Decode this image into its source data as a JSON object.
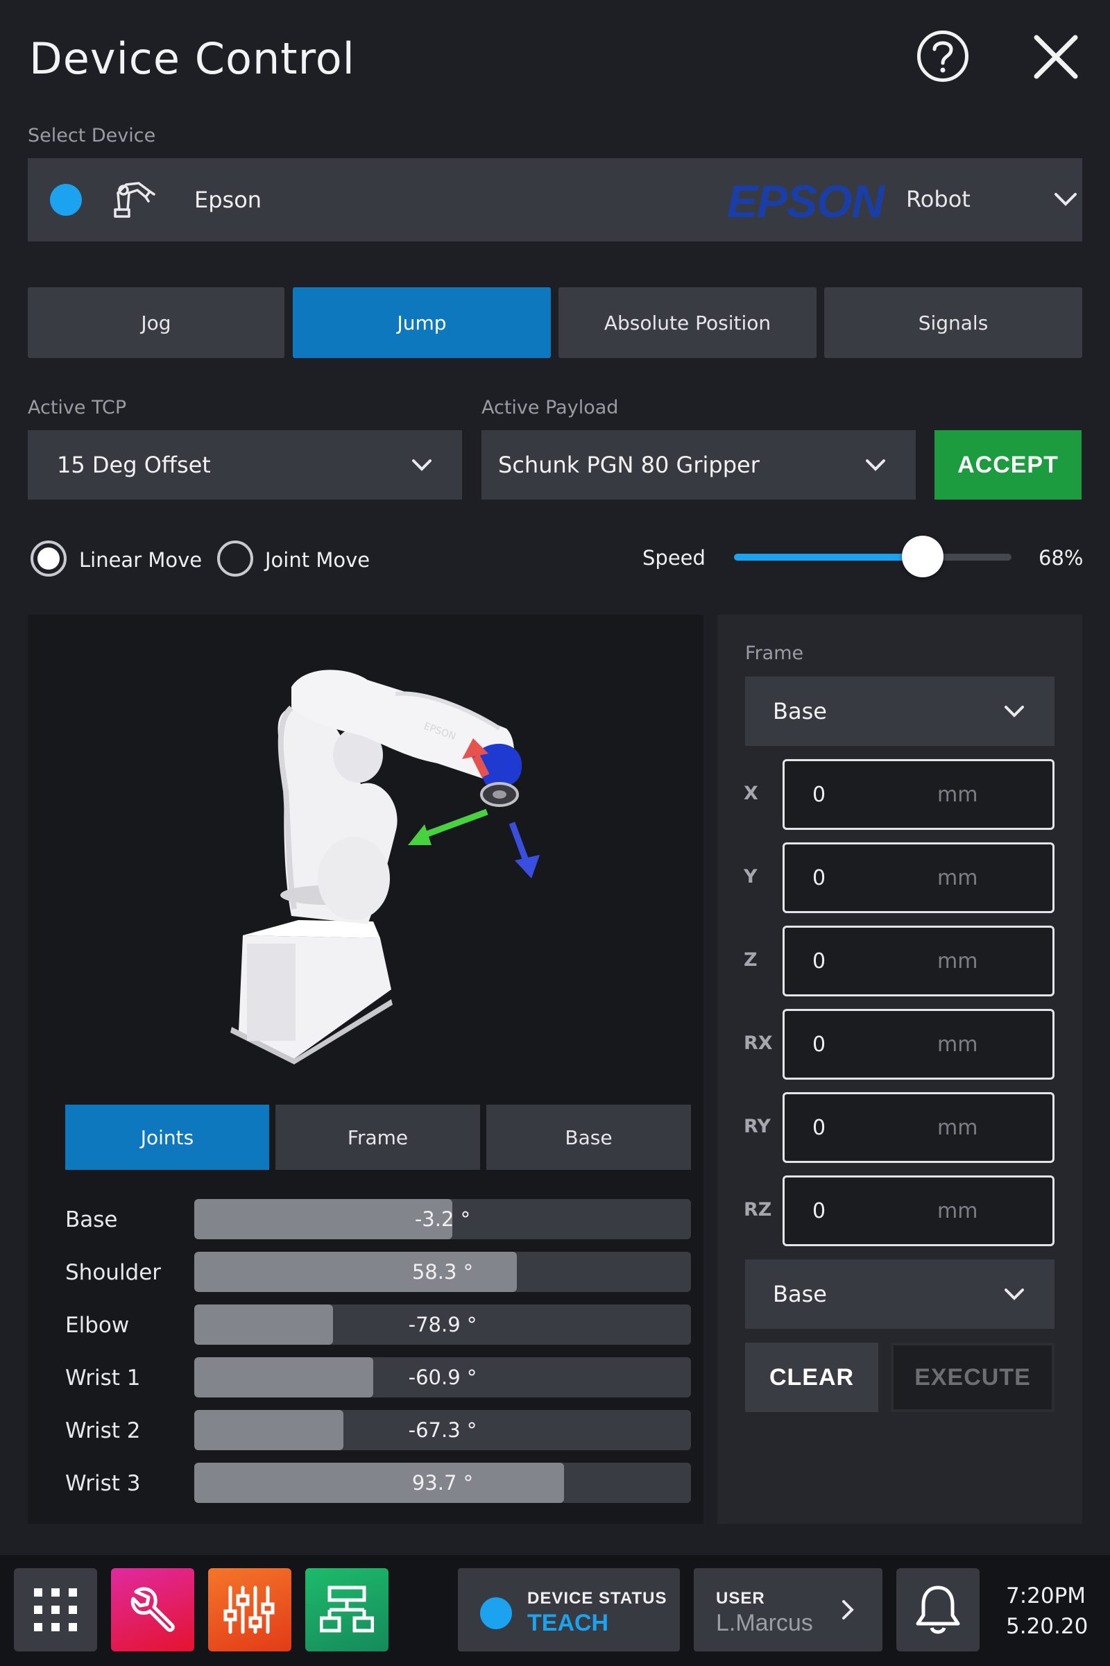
{
  "header": {
    "title": "Device Control",
    "help_icon": "help-icon",
    "close_icon": "close-icon"
  },
  "device": {
    "section_label": "Select Device",
    "status_color": "#1ca3ef",
    "name": "Epson",
    "brand_logo": "EPSON",
    "type": "Robot"
  },
  "tabs": [
    {
      "label": "Jog",
      "active": false
    },
    {
      "label": "Jump",
      "active": true
    },
    {
      "label": "Absolute Position",
      "active": false
    },
    {
      "label": "Signals",
      "active": false
    }
  ],
  "tcp": {
    "label": "Active TCP",
    "value": "15 Deg Offset"
  },
  "payload": {
    "label": "Active Payload",
    "value": "Schunk PGN 80 Gripper"
  },
  "accept_label": "ACCEPT",
  "move": {
    "linear_label": "Linear Move",
    "joint_label": "Joint Move",
    "selected": "linear"
  },
  "speed": {
    "label": "Speed",
    "value_percent": 68,
    "value_text": "68%"
  },
  "view_tabs": [
    {
      "label": "Joints",
      "active": true
    },
    {
      "label": "Frame",
      "active": false
    },
    {
      "label": "Base",
      "active": false
    }
  ],
  "joints": [
    {
      "name": "Base",
      "value_text": "-3.2 °",
      "fill": 0.52
    },
    {
      "name": "Shoulder",
      "value_text": "58.3 °",
      "fill": 0.65
    },
    {
      "name": "Elbow",
      "value_text": "-78.9 °",
      "fill": 0.28
    },
    {
      "name": "Wrist 1",
      "value_text": "-60.9 °",
      "fill": 0.36
    },
    {
      "name": "Wrist 2",
      "value_text": "-67.3 °",
      "fill": 0.3
    },
    {
      "name": "Wrist 3",
      "value_text": "93.7 °",
      "fill": 0.745
    }
  ],
  "frame_panel": {
    "frame_label": "Frame",
    "frame_value": "Base",
    "coords": [
      {
        "axis": "X",
        "value": "0",
        "unit": "mm"
      },
      {
        "axis": "Y",
        "value": "0",
        "unit": "mm"
      },
      {
        "axis": "Z",
        "value": "0",
        "unit": "mm"
      },
      {
        "axis": "RX",
        "value": "0",
        "unit": "mm"
      },
      {
        "axis": "RY",
        "value": "0",
        "unit": "mm"
      },
      {
        "axis": "RZ",
        "value": "0",
        "unit": "mm"
      }
    ],
    "ref_value": "Base",
    "clear_label": "CLEAR",
    "execute_label": "EXECUTE"
  },
  "taskbar": {
    "apps": [
      {
        "icon": "apps-grid-icon",
        "color": "#3a3c44"
      },
      {
        "icon": "wrench-icon",
        "color": "#e0208a"
      },
      {
        "icon": "sliders-icon",
        "color": "#ee5a1f"
      },
      {
        "icon": "network-icon",
        "color": "#1aa268"
      }
    ],
    "device_status": {
      "title": "DEVICE STATUS",
      "value": "TEACH",
      "color": "#1ca3ef"
    },
    "user": {
      "title": "USER",
      "value": "L.Marcus"
    },
    "bell_icon": "bell-icon",
    "time": "7:20PM",
    "date": "5.20.20"
  }
}
